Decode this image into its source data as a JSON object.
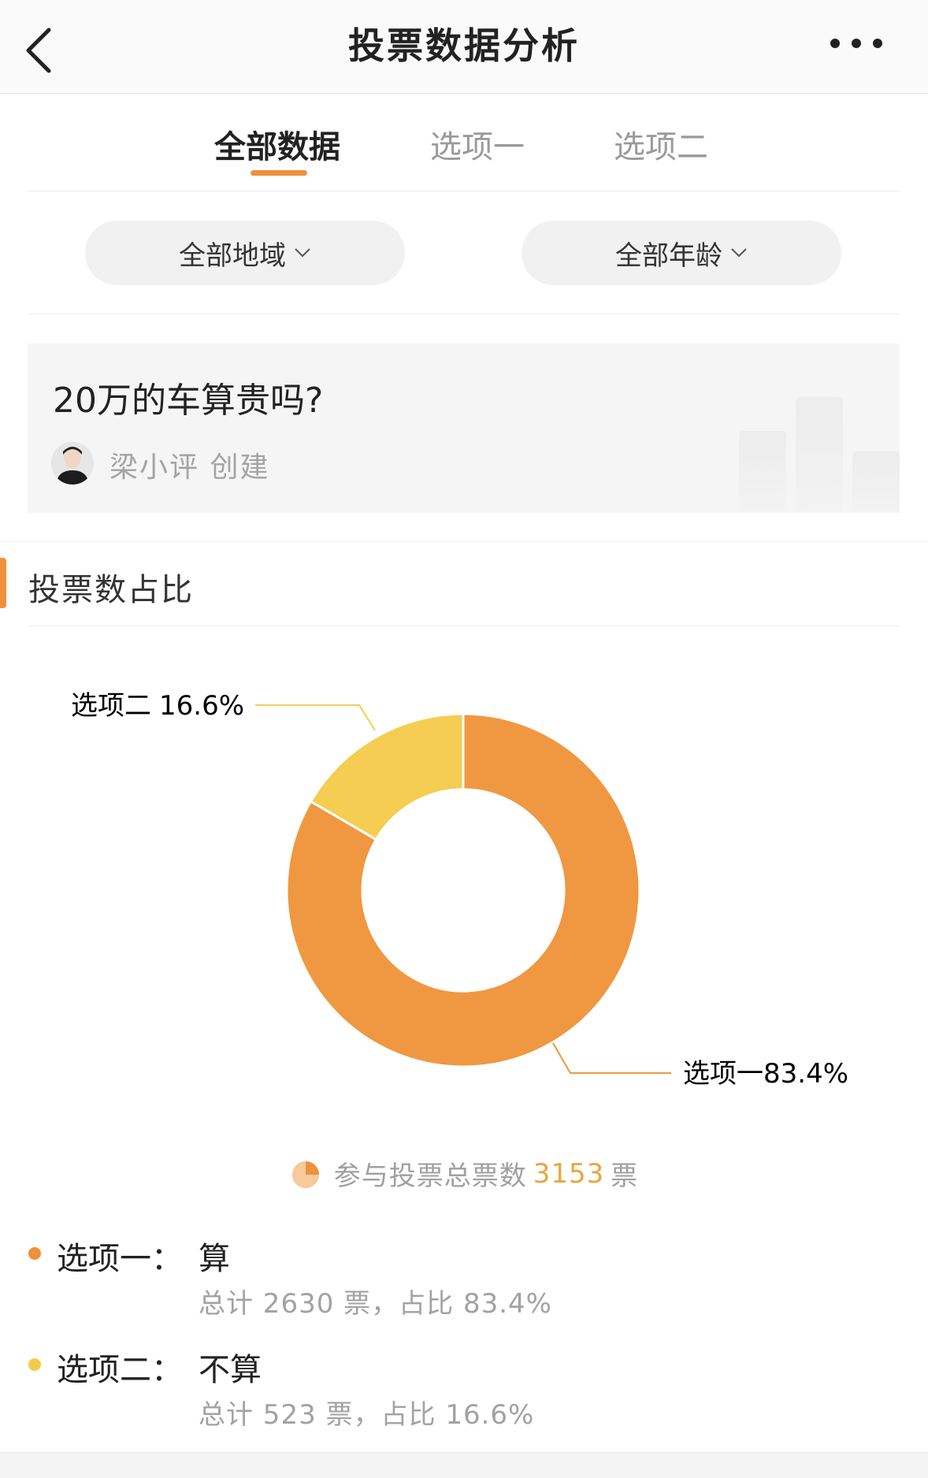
{
  "header": {
    "title": "投票数据分析",
    "back_icon": "chevron-left-icon",
    "more_icon": "more-dots-icon"
  },
  "tabs": [
    {
      "label": "全部数据",
      "active": true
    },
    {
      "label": "选项一",
      "active": false
    },
    {
      "label": "选项二",
      "active": false
    }
  ],
  "filters": {
    "region": "全部地域",
    "age": "全部年龄"
  },
  "poll": {
    "question": "20万的车算贵吗?",
    "creator": "梁小评 创建"
  },
  "section": {
    "title": "投票数占比"
  },
  "chart_data": {
    "type": "pie",
    "donut": true,
    "slices": [
      {
        "label": "选项一",
        "percent_label": "83.4%",
        "value": 83.4,
        "color": "#ef9841"
      },
      {
        "label": "选项二",
        "percent_label": "16.6%",
        "value": 16.6,
        "color": "#f4cd52"
      }
    ]
  },
  "summary": {
    "prefix": "参与投票总票数",
    "total": "3153",
    "suffix": "票"
  },
  "options": [
    {
      "name": "选项一：",
      "text": "算",
      "detail": "总计 2630 票，占比 83.4%",
      "color": "#ef913c"
    },
    {
      "name": "选项二：",
      "text": "不算",
      "detail": "总计 523 票，占比 16.6%",
      "color": "#f3cb4a"
    }
  ],
  "colors": {
    "accent": "#ef913c",
    "option1": "#ef9841",
    "option2": "#f4cd52"
  }
}
